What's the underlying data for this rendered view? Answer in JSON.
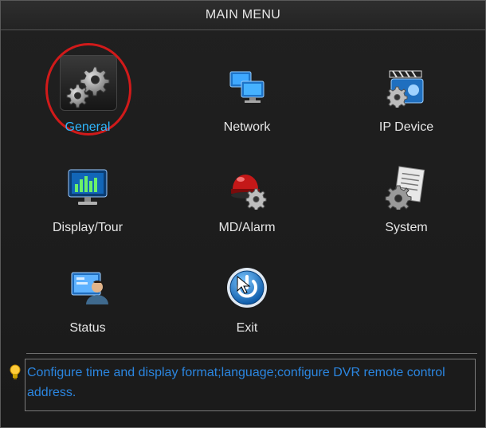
{
  "window": {
    "title": "MAIN MENU"
  },
  "menu": {
    "items": [
      {
        "label": "General",
        "icon": "gears-icon",
        "selected": true
      },
      {
        "label": "Network",
        "icon": "network-monitors-icon"
      },
      {
        "label": "IP Device",
        "icon": "camera-gear-icon"
      },
      {
        "label": "Display/Tour",
        "icon": "monitor-chart-icon"
      },
      {
        "label": "MD/Alarm",
        "icon": "alarm-light-gear-icon"
      },
      {
        "label": "System",
        "icon": "document-gear-icon"
      },
      {
        "label": "Status",
        "icon": "user-status-icon"
      },
      {
        "label": "Exit",
        "icon": "power-icon"
      }
    ]
  },
  "hint": {
    "icon": "lightbulb-icon",
    "text": "Configure time and display format;language;configure DVR remote control address."
  },
  "colors": {
    "selected_label": "#2fb7ff",
    "selection_ring": "#d11a1a",
    "hint_text": "#2b86e0"
  }
}
